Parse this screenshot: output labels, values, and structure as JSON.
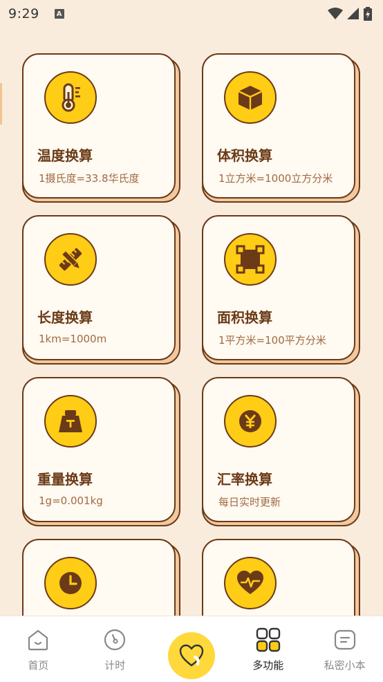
{
  "status": {
    "time": "9:29",
    "a_badge": "A"
  },
  "cards": [
    {
      "title": "温度换算",
      "subtitle": "1摄氏度=33.8华氏度",
      "icon": "thermometer-icon"
    },
    {
      "title": "体积换算",
      "subtitle": "1立方米=1000立方分米",
      "icon": "cube-icon"
    },
    {
      "title": "长度换算",
      "subtitle": "1km=1000m",
      "icon": "ruler-pencil-icon"
    },
    {
      "title": "面积换算",
      "subtitle": "1平方米=100平方分米",
      "icon": "area-frame-icon"
    },
    {
      "title": "重量换算",
      "subtitle": "1g=0.001kg",
      "icon": "weight-icon"
    },
    {
      "title": "汇率换算",
      "subtitle": "每日实时更新",
      "icon": "yen-coin-icon"
    },
    {
      "title": "",
      "subtitle": "",
      "icon": "clock-icon"
    },
    {
      "title": "",
      "subtitle": "",
      "icon": "heart-pulse-icon"
    }
  ],
  "nav": {
    "items": [
      {
        "label": "首页",
        "icon": "home-icon"
      },
      {
        "label": "计时",
        "icon": "timer-icon"
      },
      {
        "label": "",
        "icon": "heart-icon"
      },
      {
        "label": "多功能",
        "icon": "grid-icon",
        "active": true
      },
      {
        "label": "私密小本",
        "icon": "notebook-icon"
      }
    ]
  },
  "colors": {
    "background": "#f9ecdc",
    "accent": "#ffcc16",
    "outline": "#6b3a17",
    "text_brown": "#a06a42"
  }
}
